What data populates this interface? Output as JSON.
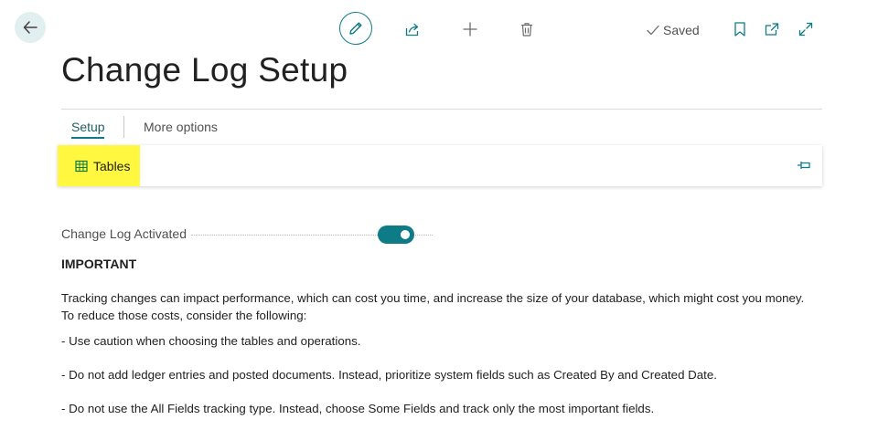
{
  "toolbar": {
    "back_icon": "back-arrow-icon",
    "edit_icon": "pencil-icon",
    "share_icon": "share-icon",
    "new_icon": "plus-icon",
    "delete_icon": "trash-icon",
    "saved_label": "Saved",
    "bookmark_icon": "bookmark-icon",
    "open_new_window_icon": "open-in-new-window-icon",
    "expand_icon": "expand-icon"
  },
  "page": {
    "title": "Change Log Setup"
  },
  "tabs": [
    {
      "label": "Setup",
      "active": true
    },
    {
      "label": "More options",
      "active": false
    }
  ],
  "actions": {
    "tables_label": "Tables",
    "tables_icon": "table-grid-icon",
    "pin_icon": "pin-icon"
  },
  "fields": {
    "change_log_activated": {
      "label": "Change Log Activated",
      "value": true
    }
  },
  "notice": {
    "heading": "IMPORTANT",
    "paragraphs": [
      "Tracking changes can impact performance, which can cost you time, and increase the size of your database, which might cost you money. To reduce those costs, consider the following:",
      "- Use caution when choosing the tables and operations.",
      "- Do not add ledger entries and posted documents. Instead, prioritize system fields such as Created By and Created Date.",
      "- Do not use the All Fields tracking type. Instead, choose Some Fields and track only the most important fields."
    ]
  },
  "colors": {
    "accent": "#0e7c86",
    "highlight": "#fff740",
    "back_button_bg": "#e1eff0",
    "text": "#212121",
    "muted_text": "#505050"
  }
}
